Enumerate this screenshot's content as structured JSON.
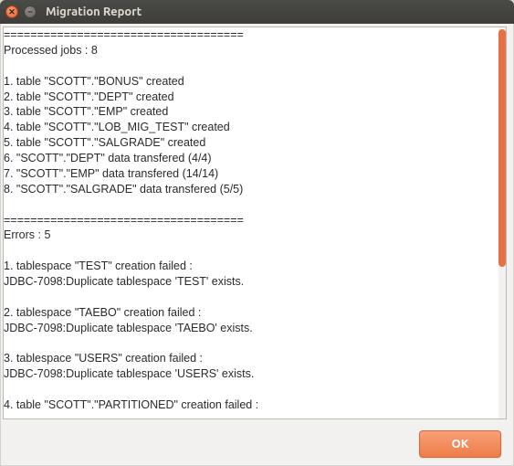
{
  "window": {
    "title": "Migration Report"
  },
  "report": {
    "divider": "====================================",
    "processed_header": "Processed jobs : 8",
    "processed_items": [
      "1. table \"SCOTT\".\"BONUS\" created",
      "2. table \"SCOTT\".\"DEPT\" created",
      "3. table \"SCOTT\".\"EMP\" created",
      "4. table \"SCOTT\".\"LOB_MIG_TEST\" created",
      "5. table \"SCOTT\".\"SALGRADE\" created",
      "6. \"SCOTT\".\"DEPT\" data transfered (4/4)",
      "7. \"SCOTT\".\"EMP\" data transfered (14/14)",
      "8. \"SCOTT\".\"SALGRADE\" data transfered (5/5)"
    ],
    "errors_header": "Errors : 5",
    "error_blocks": [
      "1. tablespace \"TEST\" creation failed :\nJDBC-7098:Duplicate tablespace 'TEST' exists.",
      "2. tablespace \"TAEBO\" creation failed :\nJDBC-7098:Duplicate tablespace 'TAEBO' exists.",
      "3. tablespace \"USERS\" creation failed :\nJDBC-7098:Duplicate tablespace 'USERS' exists.",
      "4. table \"SCOTT\".\"PARTITIONED\" creation failed :"
    ]
  },
  "buttons": {
    "ok_label": "OK"
  }
}
